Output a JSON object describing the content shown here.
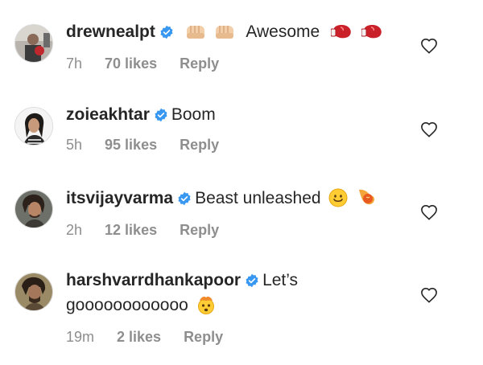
{
  "comments": [
    {
      "username": "drewnealpt",
      "text": "Awesome",
      "time": "7h",
      "likes": "70 likes",
      "reply": "Reply",
      "emojis_before": [
        "fist-emoji",
        "fist-emoji"
      ],
      "emojis_after": [
        "boxing-glove-emoji",
        "boxing-glove-emoji"
      ]
    },
    {
      "username": "zoieakhtar",
      "text": "Boom",
      "time": "5h",
      "likes": "95 likes",
      "reply": "Reply"
    },
    {
      "username": "itsvijayvarma",
      "text": "Beast unleashed",
      "time": "2h",
      "likes": "12 likes",
      "reply": "Reply",
      "emojis_after": [
        "smiling-emoji",
        "fire-emoji"
      ]
    },
    {
      "username": "harshvarrdhankapoor",
      "text_line1": "Let’s",
      "text_line2": "goooooooooooo",
      "time": "19m",
      "likes": "2 likes",
      "reply": "Reply",
      "emojis_after": [
        "mind-blown-emoji"
      ]
    }
  ],
  "colors": {
    "text": "#262626",
    "meta": "#8e8e8e",
    "verified": "#3897f0"
  }
}
